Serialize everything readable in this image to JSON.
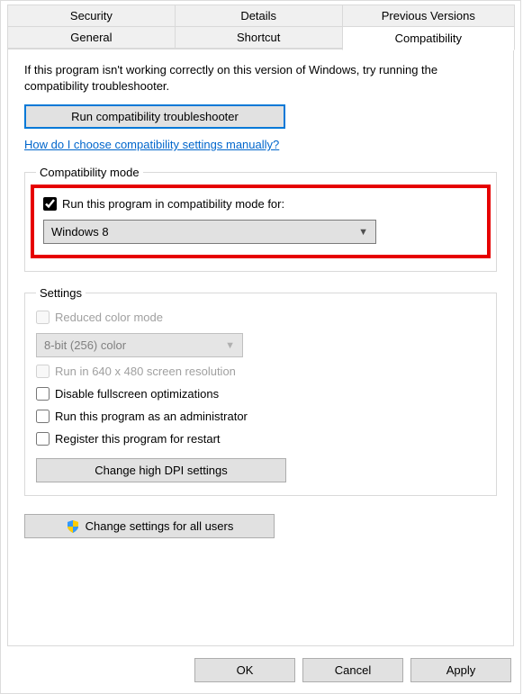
{
  "tabs": {
    "row1": [
      "Security",
      "Details",
      "Previous Versions"
    ],
    "row2": [
      "General",
      "Shortcut",
      "Compatibility"
    ],
    "selected": "Compatibility"
  },
  "intro": "If this program isn't working correctly on this version of Windows, try running the compatibility troubleshooter.",
  "troubleshootBtn": "Run compatibility troubleshooter",
  "manualLink": "How do I choose compatibility settings manually?",
  "compatMode": {
    "legend": "Compatibility mode",
    "checkLabel": "Run this program in compatibility mode for:",
    "checked": true,
    "selected": "Windows 8"
  },
  "settings": {
    "legend": "Settings",
    "reducedColor": {
      "label": "Reduced color mode",
      "checked": false,
      "enabled": false
    },
    "colorSelect": "8-bit (256) color",
    "run640": {
      "label": "Run in 640 x 480 screen resolution",
      "checked": false,
      "enabled": false
    },
    "disableFullscreen": {
      "label": "Disable fullscreen optimizations",
      "checked": false
    },
    "runAsAdmin": {
      "label": "Run this program as an administrator",
      "checked": false
    },
    "registerRestart": {
      "label": "Register this program for restart",
      "checked": false
    },
    "dpiBtn": "Change high DPI settings"
  },
  "allUsersBtn": "Change settings for all users",
  "buttons": {
    "ok": "OK",
    "cancel": "Cancel",
    "apply": "Apply"
  }
}
